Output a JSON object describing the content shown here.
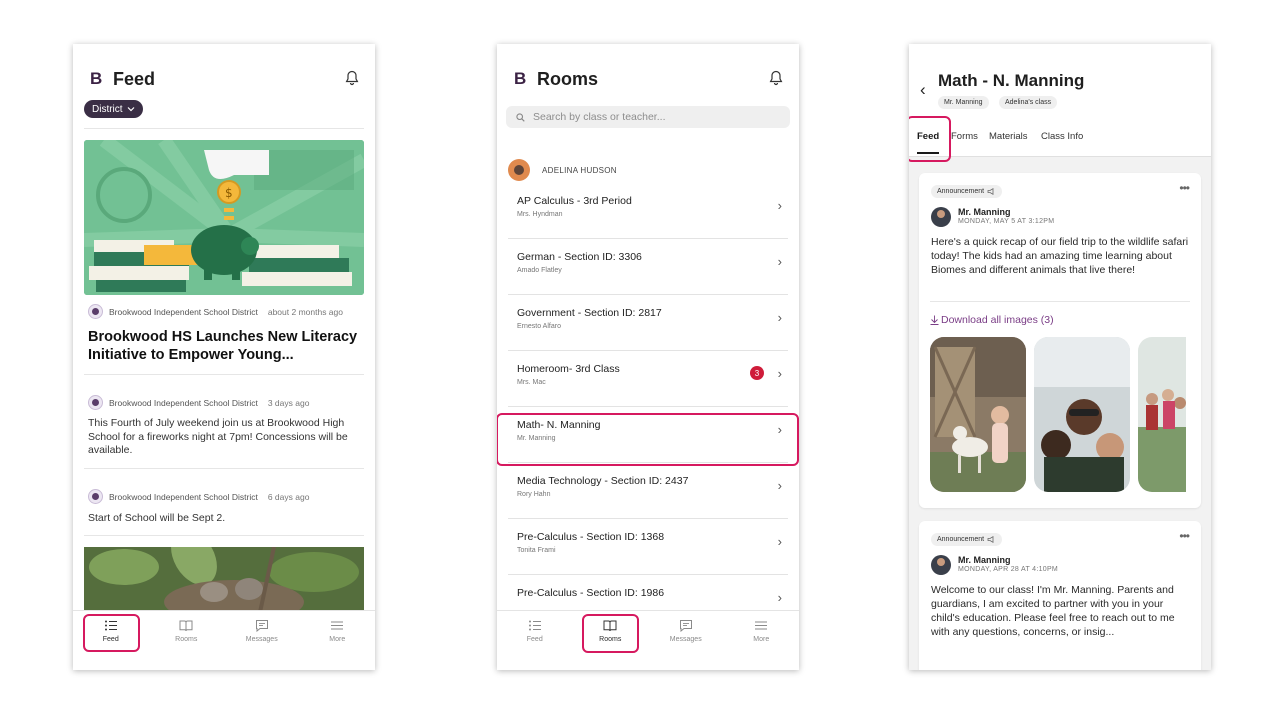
{
  "colors": {
    "highlight": "#d6195f",
    "brand": "#3b2244",
    "badge": "#cf1c3a",
    "link": "#7a3d86"
  },
  "feed_screen": {
    "logo": "B",
    "title": "Feed",
    "filter_pill": "District",
    "posts": [
      {
        "source": "Brookwood Independent School District",
        "ago": "about 2 months ago",
        "headline": "Brookwood HS Launches New Literacy Initiative to Empower Young..."
      },
      {
        "source": "Brookwood Independent School District",
        "ago": "3 days ago",
        "body": "This Fourth of July weekend join us at Brookwood High School for a fireworks night at 7pm! Concessions will be available."
      },
      {
        "source": "Brookwood Independent School District",
        "ago": "6 days ago",
        "body": "Start of School will be Sept 2."
      }
    ]
  },
  "rooms_screen": {
    "logo": "B",
    "title": "Rooms",
    "search_placeholder": "Search by class or teacher...",
    "student_name": "ADELINA HUDSON",
    "rooms": [
      {
        "title": "AP Calculus - 3rd Period",
        "teacher": "Mrs. Hyndman"
      },
      {
        "title": "German - Section ID: 3306",
        "teacher": "Amado Flatley"
      },
      {
        "title": "Government - Section ID: 2817",
        "teacher": "Ernesto Alfaro"
      },
      {
        "title": "Homeroom- 3rd Class",
        "teacher": "Mrs. Mac",
        "badge": "3"
      },
      {
        "title": "Math- N. Manning",
        "teacher": "Mr. Manning"
      },
      {
        "title": "Media Technology - Section ID: 2437",
        "teacher": "Rory Hahn"
      },
      {
        "title": "Pre-Calculus - Section ID: 1368",
        "teacher": "Tonita Frami"
      },
      {
        "title": "Pre-Calculus - Section ID: 1986",
        "teacher": ""
      }
    ]
  },
  "tabbar": {
    "feed": "Feed",
    "rooms": "Rooms",
    "messages": "Messages",
    "more": "More"
  },
  "class_screen": {
    "title": "Math - N. Manning",
    "chips": [
      "Mr. Manning",
      "Adelina's class"
    ],
    "tabs": [
      "Feed",
      "Forms",
      "Materials",
      "Class Info"
    ],
    "posts": [
      {
        "type": "Announcement",
        "author": "Mr. Manning",
        "date": "MONDAY, MAY 5 AT 3:12PM",
        "text": "Here's a quick recap of our field trip to the wildlife safari today! The kids had an amazing time learning about Biomes and different animals that live there!",
        "download": "Download all images (3)"
      },
      {
        "type": "Announcement",
        "author": "Mr. Manning",
        "date": "MONDAY, APR 28 AT 4:10PM",
        "text": "Welcome to our class! I'm Mr. Manning. Parents and guardians, I am excited to partner with you in your child's education. Please feel free to reach out to me with any questions, concerns, or insig..."
      }
    ]
  },
  "icons": {
    "bell": "bell-icon",
    "chevron": "chevron-right-icon",
    "back": "back-arrow-icon",
    "search": "search-icon",
    "megaphone": "megaphone-icon",
    "download": "download-icon"
  }
}
